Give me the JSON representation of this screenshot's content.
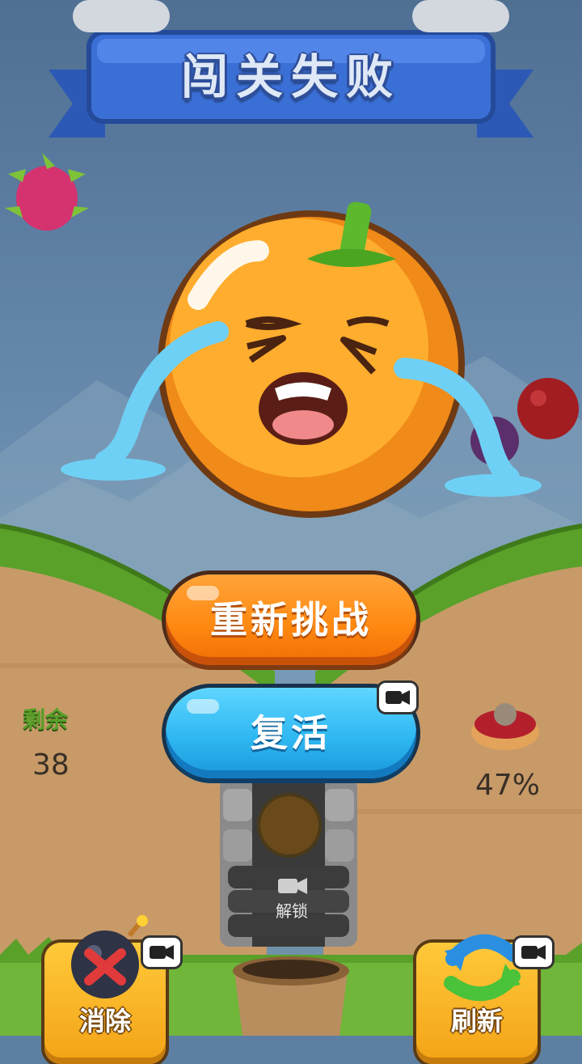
{
  "banner": {
    "title": "闯关失败"
  },
  "buttons": {
    "retry_label": "重新挑战",
    "revive_label": "复活"
  },
  "stats": {
    "remaining_label": "剩余",
    "remaining_value": "38",
    "progress_value": "47%"
  },
  "tools": {
    "bomb_label": "消除",
    "refresh_label": "刷新",
    "unlock_label": "解锁"
  },
  "colors": {
    "orange": "#ff8a12",
    "blue": "#2fb8f2",
    "grass": "#5aa12a",
    "banner": "#3a6fd6"
  },
  "icons": [
    "video-icon",
    "bomb-icon",
    "refresh-icon",
    "dragon-fruit-icon",
    "tart-icon",
    "sack-icon",
    "crying-orange"
  ]
}
